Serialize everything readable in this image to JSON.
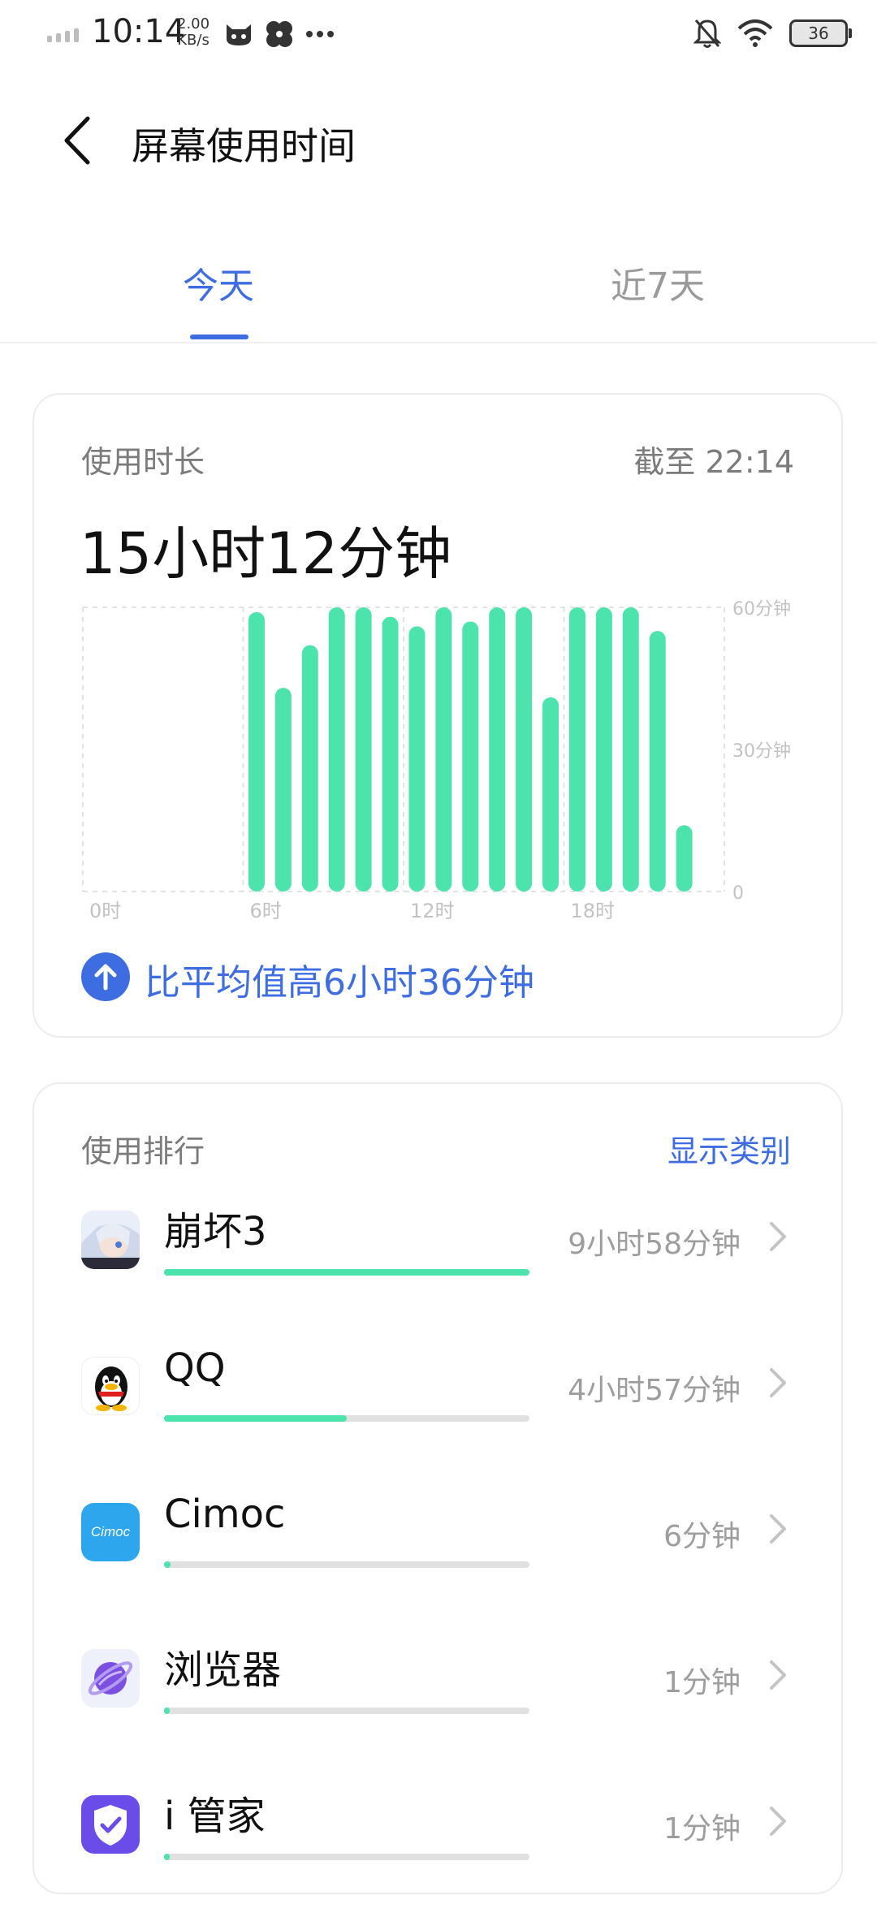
{
  "status": {
    "time": "10:14",
    "speed_value": "2.00",
    "speed_unit": "KB/s",
    "battery": "36"
  },
  "header": {
    "title": "屏幕使用时间"
  },
  "tabs": [
    {
      "label": "今天",
      "active": true
    },
    {
      "label": "近7天",
      "active": false
    }
  ],
  "usage": {
    "label": "使用时长",
    "as_of": "截至 22:14",
    "total": "15小时12分钟",
    "comparison": "比平均值高6小时36分钟"
  },
  "chart_data": {
    "type": "bar",
    "categories": [
      "0",
      "1",
      "2",
      "3",
      "4",
      "5",
      "6",
      "7",
      "8",
      "9",
      "10",
      "11",
      "12",
      "13",
      "14",
      "15",
      "16",
      "17",
      "18",
      "19",
      "20",
      "21",
      "22",
      "23"
    ],
    "values": [
      0,
      0,
      0,
      0,
      0,
      0,
      59,
      43,
      52,
      60,
      60,
      58,
      56,
      60,
      57,
      60,
      60,
      41,
      60,
      60,
      60,
      55,
      14,
      0
    ],
    "unit": "分钟",
    "ylim": [
      0,
      60
    ],
    "y_ticks": [
      "0",
      "30分钟",
      "60分钟"
    ],
    "x_tick_labels": [
      "0时",
      "6时",
      "12时",
      "18时"
    ],
    "bar_color": "#4de3ad",
    "grid": true
  },
  "ranking": {
    "title": "使用排行",
    "toggle": "显示类别",
    "apps": [
      {
        "name": "崩坏3",
        "time": "9小时58分钟",
        "fraction": 1.0,
        "icon": "honkai-icon"
      },
      {
        "name": "QQ",
        "time": "4小时57分钟",
        "fraction": 0.5,
        "icon": "qq-penguin-icon"
      },
      {
        "name": "Cimoc",
        "time": "6分钟",
        "fraction": 0.018,
        "icon": "cimoc-icon",
        "icon_text": "Cimoc"
      },
      {
        "name": "浏览器",
        "time": "1分钟",
        "fraction": 0.008,
        "icon": "browser-planet-icon"
      },
      {
        "name": "i 管家",
        "time": "1分钟",
        "fraction": 0.008,
        "icon": "shield-check-icon"
      }
    ]
  },
  "colors": {
    "accent": "#3d6de0",
    "bar": "#4de3ad",
    "muted": "#7b7b7b"
  }
}
